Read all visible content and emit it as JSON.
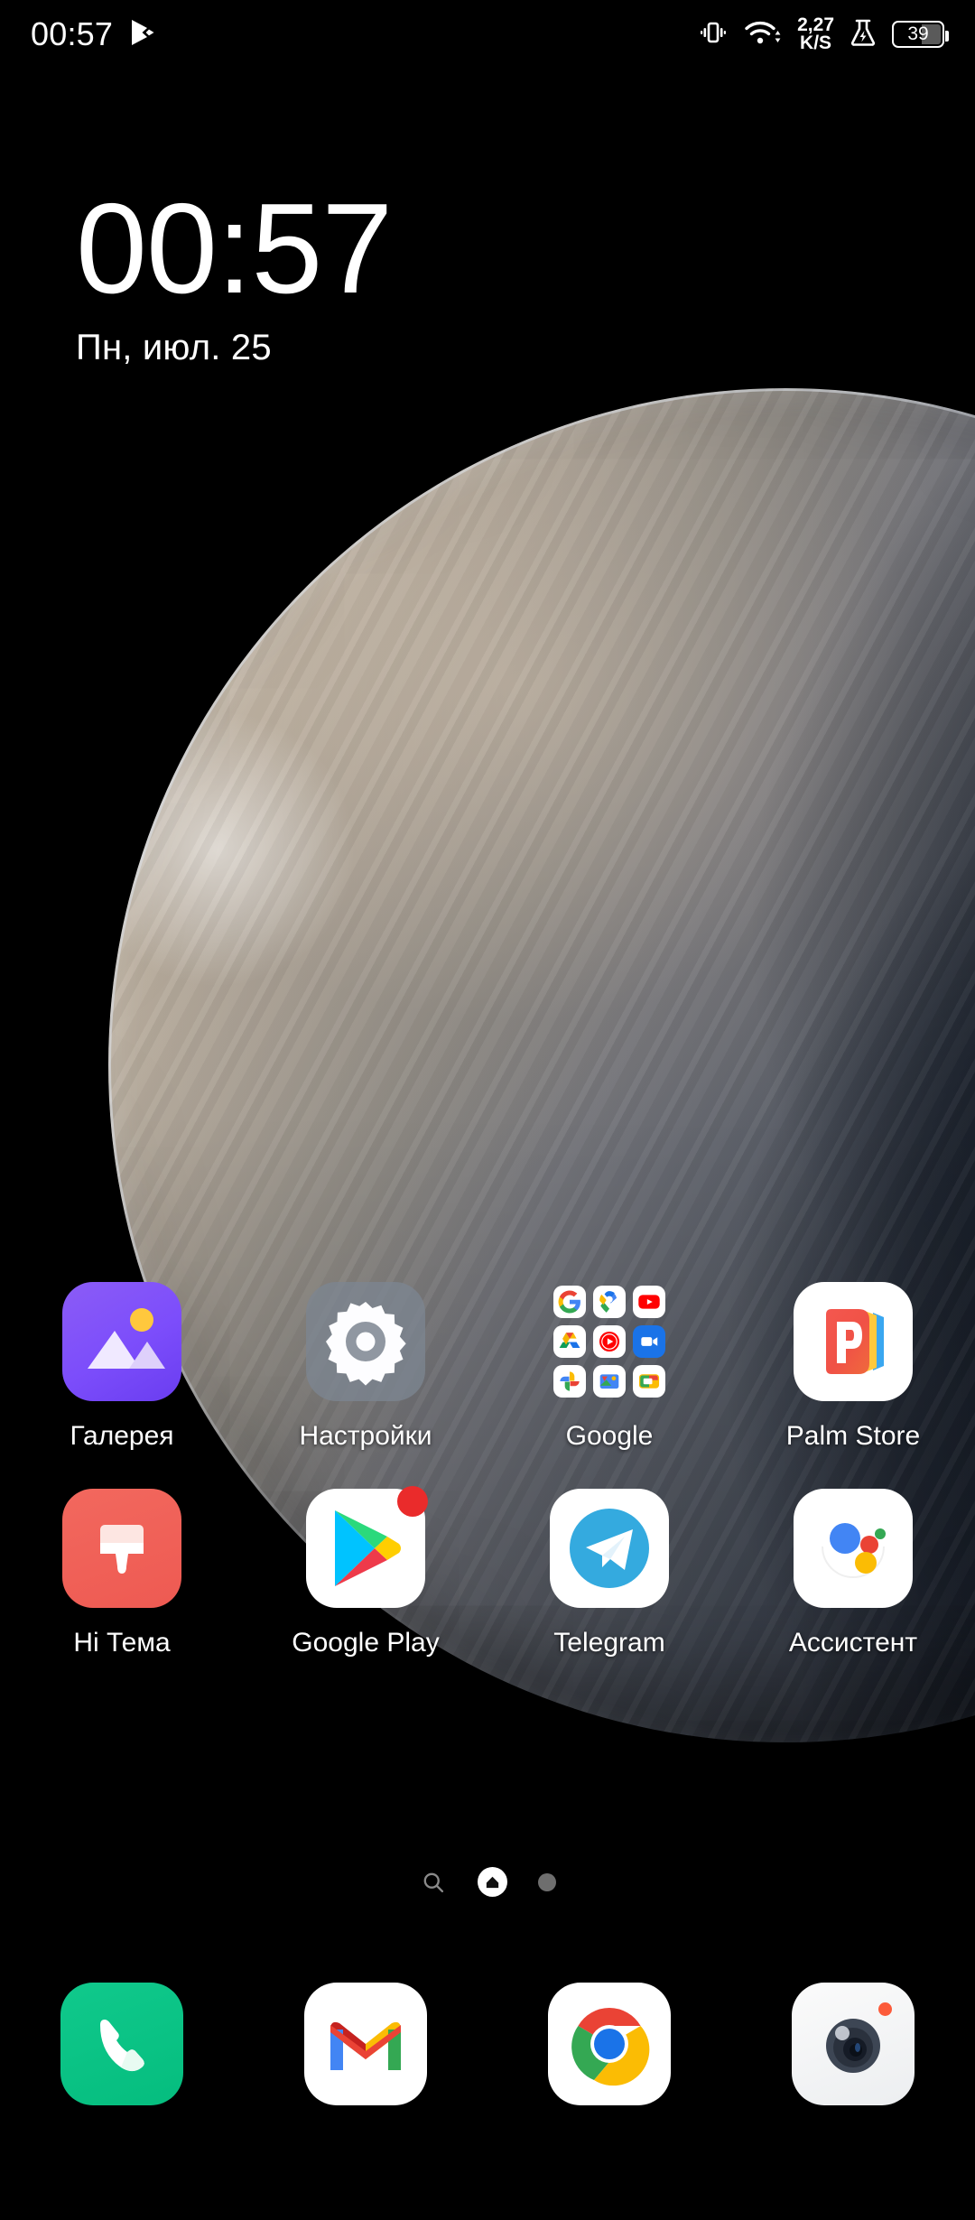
{
  "status_bar": {
    "clock": "00:57",
    "left_icons": [
      "play-store-notification-icon"
    ],
    "net_speed_value": "2,27",
    "net_speed_unit": "K/S",
    "battery_percent": "39",
    "right_icons": [
      "vibrate-icon",
      "wifi-icon",
      "network-speed",
      "flask-icon",
      "battery-icon"
    ]
  },
  "clock_widget": {
    "time": "00:57",
    "date": "Пн, июл. 25"
  },
  "app_grid": {
    "rows": [
      [
        {
          "label": "Галерея",
          "icon": "gallery-icon"
        },
        {
          "label": "Настройки",
          "icon": "settings-icon"
        },
        {
          "label": "Google",
          "icon": "google-folder-icon"
        },
        {
          "label": "Palm Store",
          "icon": "palm-store-icon"
        }
      ],
      [
        {
          "label": "Hi Тема",
          "icon": "hi-theme-icon"
        },
        {
          "label": "Google Play",
          "icon": "google-play-icon",
          "badge": true
        },
        {
          "label": "Telegram",
          "icon": "telegram-icon"
        },
        {
          "label": "Ассистент",
          "icon": "google-assistant-icon"
        }
      ]
    ],
    "google_folder_apps": [
      "google-search-icon",
      "google-maps-icon",
      "youtube-icon",
      "google-drive-icon",
      "youtube-music-icon",
      "google-meet-icon",
      "google-photos-icon",
      "google-files-icon",
      "google-tv-icon"
    ]
  },
  "page_indicator": {
    "items": [
      "search-icon",
      "home-page-current",
      "page-dot"
    ],
    "current_page": 2,
    "total_pages": 3
  },
  "dock": {
    "items": [
      {
        "label": "Phone",
        "icon": "phone-icon"
      },
      {
        "label": "Gmail",
        "icon": "gmail-icon"
      },
      {
        "label": "Chrome",
        "icon": "chrome-icon"
      },
      {
        "label": "Camera",
        "icon": "camera-icon",
        "badge": true
      }
    ]
  },
  "colors": {
    "background": "#000000",
    "accent_purple": "#7c4dfb",
    "accent_red": "#ee5a52",
    "accent_green": "#05bd7e",
    "badge_red": "#ea2b2b",
    "text": "#ffffff"
  }
}
